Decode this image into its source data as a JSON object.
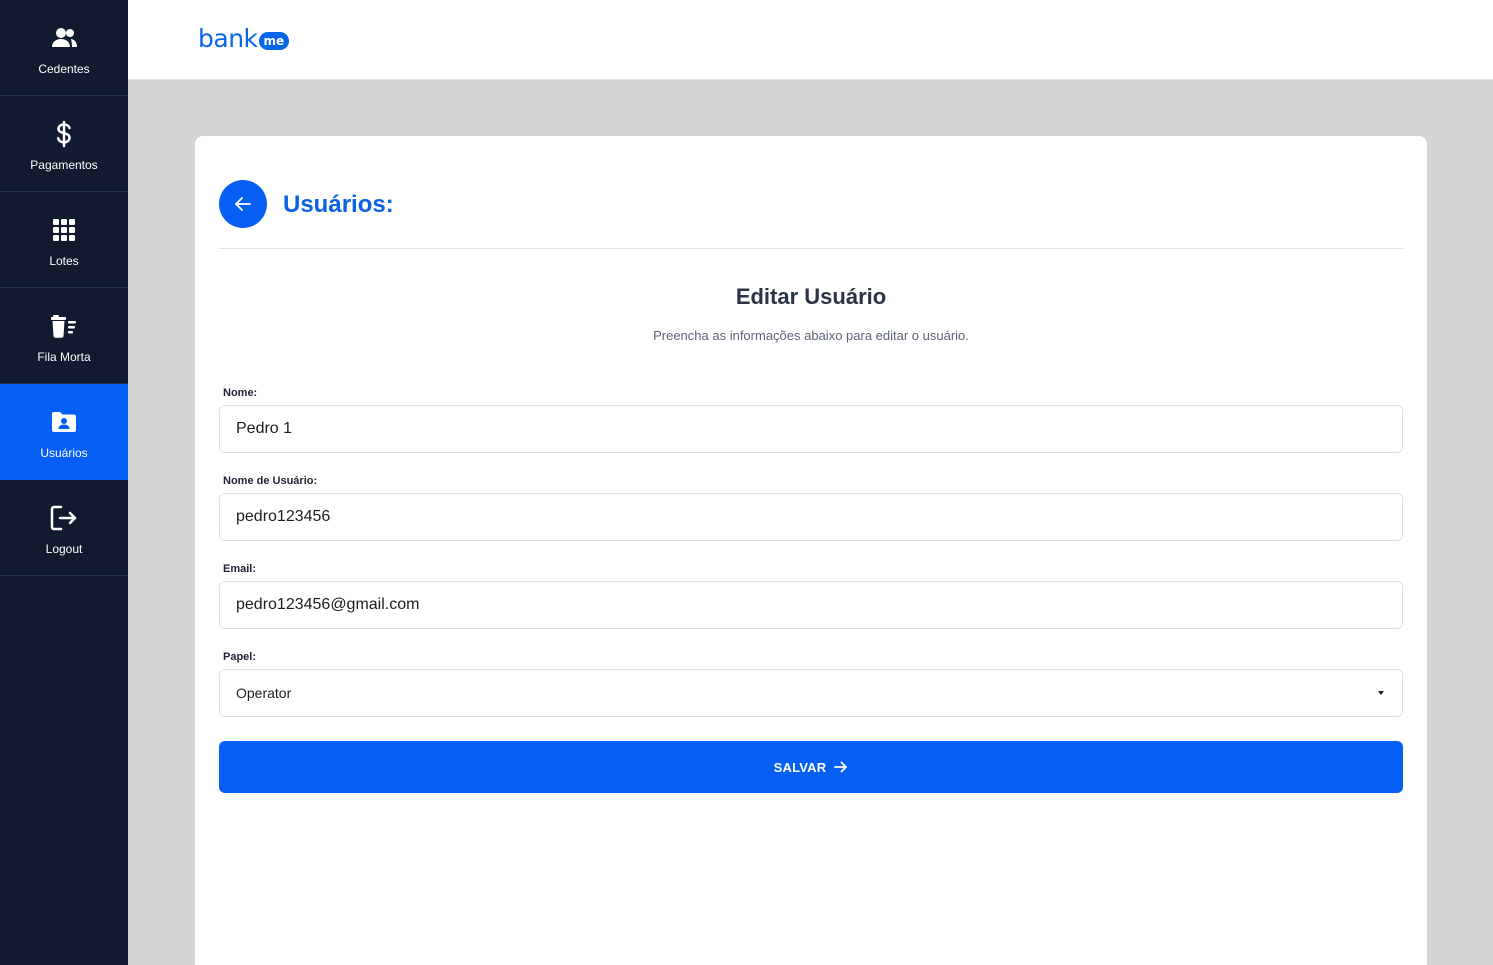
{
  "sidebar": {
    "items": [
      {
        "label": "Cedentes",
        "icon": "users-icon",
        "active": false
      },
      {
        "label": "Pagamentos",
        "icon": "dollar-icon",
        "active": false
      },
      {
        "label": "Lotes",
        "icon": "grid-icon",
        "active": false
      },
      {
        "label": "Fila Morta",
        "icon": "trash-list-icon",
        "active": false
      },
      {
        "label": "Usuários",
        "icon": "user-folder-icon",
        "active": true
      },
      {
        "label": "Logout",
        "icon": "logout-icon",
        "active": false
      }
    ]
  },
  "header": {
    "logo_text": "bank",
    "logo_badge": "me"
  },
  "page": {
    "title": "Usuários:",
    "form_title": "Editar Usuário",
    "form_subtitle": "Preencha as informações abaixo para editar o usuário."
  },
  "form": {
    "name": {
      "label": "Nome:",
      "value": "Pedro 1"
    },
    "username": {
      "label": "Nome de Usuário:",
      "value": "pedro123456"
    },
    "email": {
      "label": "Email:",
      "value": "pedro123456@gmail.com"
    },
    "role": {
      "label": "Papel:",
      "value": "Operator"
    },
    "submit_label": "SALVAR"
  },
  "colors": {
    "sidebar_bg": "#111a2e",
    "accent": "#065ff5",
    "page_bg": "#d4d4d4"
  }
}
